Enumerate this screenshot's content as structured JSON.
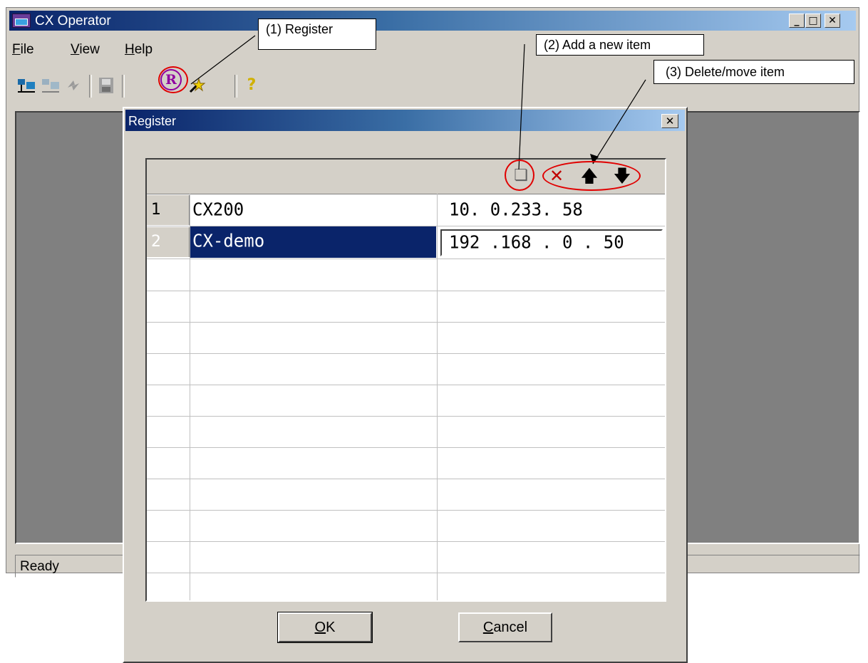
{
  "window": {
    "title": "CX Operator",
    "minimize_glyph": "_",
    "maximize_glyph": "□",
    "close_glyph": "✕"
  },
  "menu": [
    {
      "key": "F",
      "rest": "ile"
    },
    {
      "key": "V",
      "rest": "iew"
    },
    {
      "key": "H",
      "rest": "elp"
    }
  ],
  "toolbar": {
    "icons": [
      "connect-icon",
      "disconnect-icon",
      "refresh-icon",
      "save-icon",
      "register-icon",
      "wizard-icon",
      "help-icon"
    ],
    "register_glyph": "R",
    "help_glyph": "?"
  },
  "status": {
    "text": "Ready"
  },
  "dialog": {
    "title": "Register",
    "close_glyph": "✕",
    "grid_toolbar": {
      "add_glyph": "❏",
      "delete_glyph": "✕",
      "up_glyph": "🡅",
      "down_glyph": "🡇"
    },
    "rows": [
      {
        "num": "1",
        "name": "CX200",
        "address": "10.  0.233. 58"
      },
      {
        "num": "2",
        "name": "CX-demo",
        "address": "192 .168 . 0  . 50"
      }
    ],
    "ok_button": {
      "key": "O",
      "rest": "K"
    },
    "cancel_button": {
      "key": "C",
      "rest": "ancel"
    }
  },
  "annotations": [
    "(1) Register",
    "(2) Add a new item",
    "(3) Delete/move item"
  ],
  "colors": {
    "selection": "#0a246a",
    "annotation_red": "#e00000",
    "window_face": "#d4d0c8"
  }
}
